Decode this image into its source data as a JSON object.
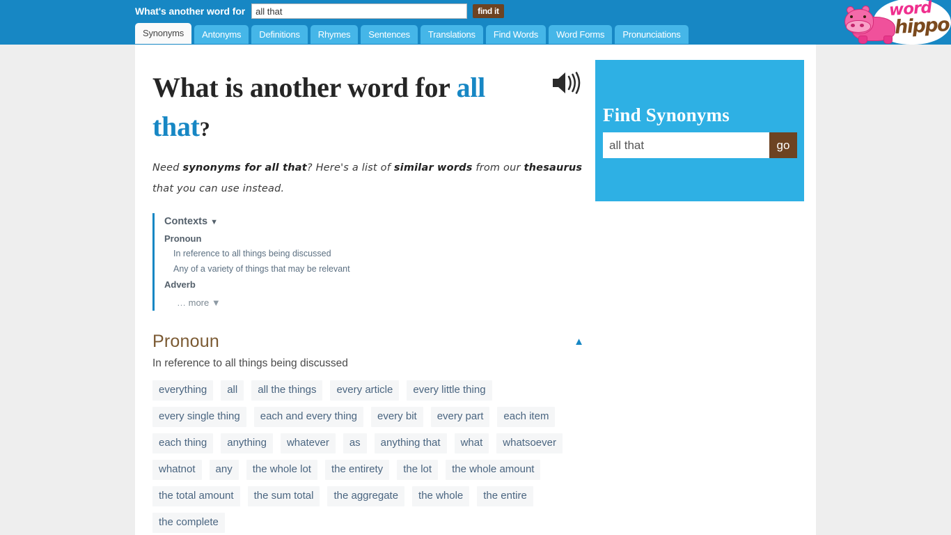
{
  "header": {
    "search_label": "What's another word for",
    "search_value": "all that",
    "search_placeholder": "",
    "find_button": "find it",
    "star_icon": "sun-icon",
    "tabs": [
      {
        "label": "Synonyms",
        "active": true
      },
      {
        "label": "Antonyms",
        "active": false
      },
      {
        "label": "Definitions",
        "active": false
      },
      {
        "label": "Rhymes",
        "active": false
      },
      {
        "label": "Sentences",
        "active": false
      },
      {
        "label": "Translations",
        "active": false
      },
      {
        "label": "Find Words",
        "active": false
      },
      {
        "label": "Word Forms",
        "active": false
      },
      {
        "label": "Pronunciations",
        "active": false
      }
    ],
    "logo": {
      "word": "word",
      "hippo": "hippo",
      "word_color": "#ef2f8e",
      "hippo_color": "#7b4a1e"
    },
    "bg_color": "#1787c4"
  },
  "main": {
    "title_prefix": "What is another word for ",
    "title_query": "all that",
    "title_suffix": "?",
    "speaker_icon": "speaker-icon",
    "intro": {
      "part1": "Need ",
      "bold1": "synonyms for all that",
      "part2": "? Here's a list of ",
      "bold2": "similar words",
      "part3": " from our ",
      "bold3": "thesaurus",
      "part4": " that you can use instead."
    },
    "contexts": {
      "title": "Contexts",
      "caret": "▼",
      "groups": [
        {
          "pos": "Pronoun",
          "senses": [
            "In reference to all things being discussed",
            "Any of a variety of things that may be relevant"
          ]
        },
        {
          "pos": "Adverb",
          "senses": []
        }
      ],
      "more_dots": "… ",
      "more_label": "more ",
      "more_caret": "▼"
    },
    "pos_section": {
      "heading": "Pronoun",
      "sense": "In reference to all things being discussed",
      "collapse_icon": "▲",
      "collapse_color": "#1787c4",
      "synonyms": [
        "everything",
        "all",
        "all the things",
        "every article",
        "every little thing",
        "every single thing",
        "each and every thing",
        "every bit",
        "every part",
        "each item",
        "each thing",
        "anything",
        "whatever",
        "as",
        "anything that",
        "what",
        "whatsoever",
        "whatnot",
        "any",
        "the whole lot",
        "the entirety",
        "the lot",
        "the whole amount",
        "the total amount",
        "the sum total",
        "the aggregate",
        "the whole",
        "the entire",
        "the complete"
      ]
    }
  },
  "sidebar": {
    "title": "Find Synonyms",
    "search_value": "all that",
    "search_placeholder": "",
    "go_button": "go",
    "bg_color": "#2eb0e4",
    "go_color": "#6d4322"
  }
}
